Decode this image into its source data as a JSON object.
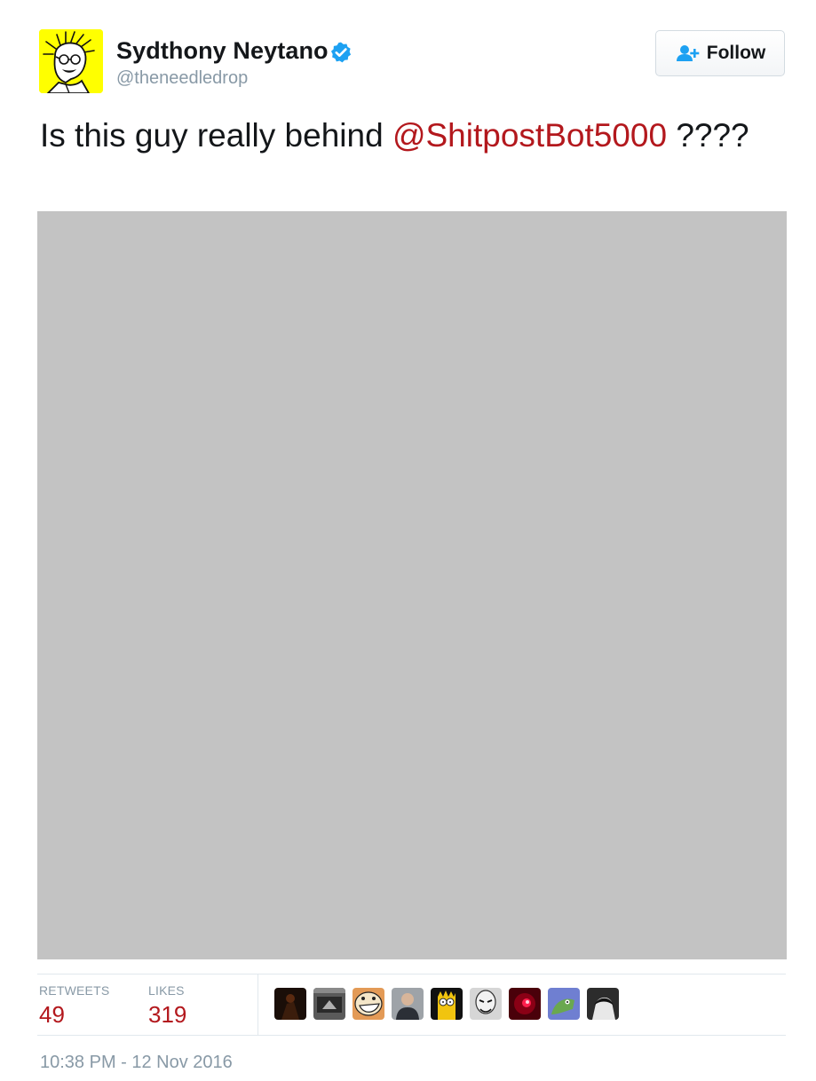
{
  "author": {
    "display_name": "Sydthony Neytano",
    "handle": "@theneedledrop",
    "verified": true,
    "avatar_icon": "cartoon-portrait-avatar",
    "avatar_bg": "#ffff00"
  },
  "follow_button": {
    "label": "Follow",
    "icon": "add-user-icon"
  },
  "tweet": {
    "text_before": "Is this guy really behind ",
    "mention": "@ShitpostBot5000",
    "text_after": " ????"
  },
  "media": {
    "placeholder_color": "#c3c3c3"
  },
  "stats": {
    "retweets_label": "RETWEETS",
    "retweets_value": "49",
    "likes_label": "LIKES",
    "likes_value": "319"
  },
  "likers": [
    {
      "name": "liker-1",
      "color": "#1a0e08"
    },
    {
      "name": "liker-2",
      "color": "#5a5a5a"
    },
    {
      "name": "liker-3",
      "color": "#e39a56"
    },
    {
      "name": "liker-4",
      "color": "#9ea3a8"
    },
    {
      "name": "liker-5",
      "color": "#f1c40f"
    },
    {
      "name": "liker-6",
      "color": "#d6d6d6"
    },
    {
      "name": "liker-7",
      "color": "#4a000a"
    },
    {
      "name": "liker-8",
      "color": "#6f7fd1"
    },
    {
      "name": "liker-9",
      "color": "#2c2c2c"
    }
  ],
  "timestamp": "10:38 PM - 12 Nov 2016",
  "colors": {
    "link": "#b3181d",
    "muted": "#8899a6",
    "verified": "#1da1f2",
    "follow_icon": "#1da1f2"
  }
}
